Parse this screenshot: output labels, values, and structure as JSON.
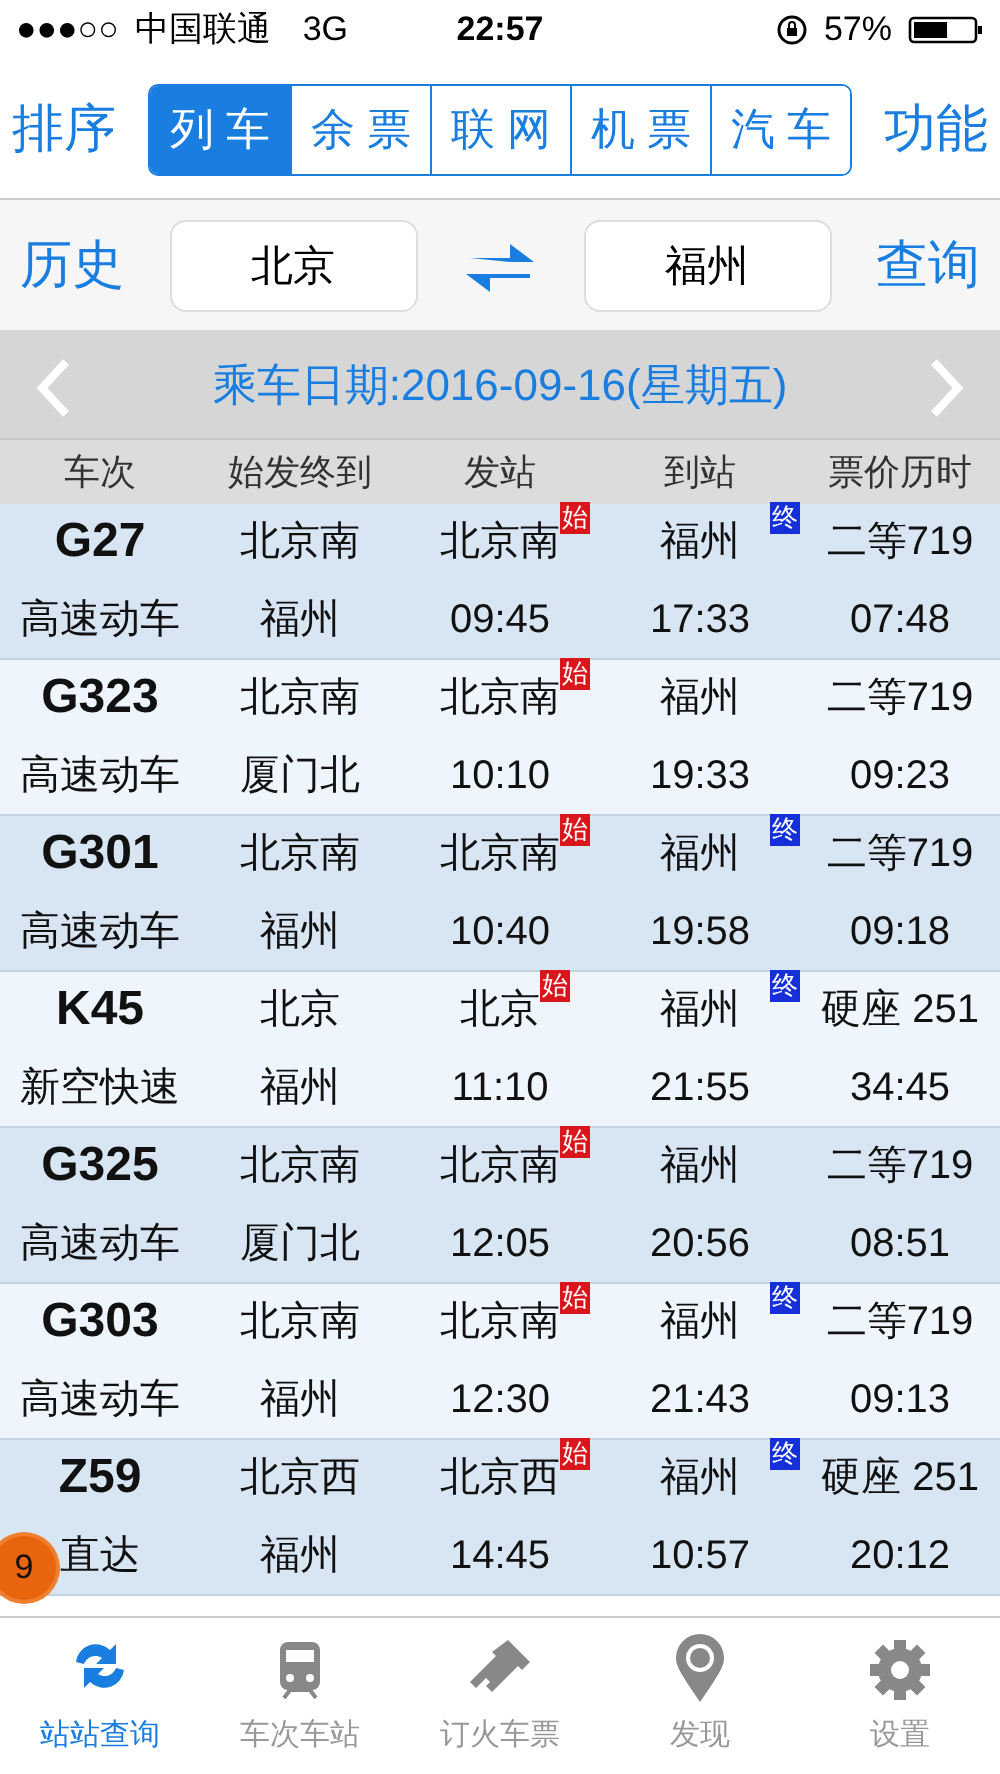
{
  "status_bar": {
    "signal": "●●●○○",
    "carrier": "中国联通",
    "network": "3G",
    "time": "22:57",
    "battery": "57%"
  },
  "top_bar": {
    "left_button": "排序",
    "right_button": "功能",
    "segments": [
      {
        "label": "列 车",
        "selected": true
      },
      {
        "label": "余 票",
        "selected": false
      },
      {
        "label": "联 网",
        "selected": false
      },
      {
        "label": "机 票",
        "selected": false
      },
      {
        "label": "汽 车",
        "selected": false
      }
    ]
  },
  "search": {
    "history_button": "历史",
    "from": "北京",
    "to": "福州",
    "query_button": "查询"
  },
  "date_bar": {
    "label": "乘车日期:2016-09-16(星期五)"
  },
  "table": {
    "columns": [
      "车次",
      "始发终到",
      "发站",
      "到站",
      "票价历时"
    ],
    "rows": [
      {
        "train": "G27",
        "type": "高速动车",
        "origin": "北京南",
        "terminus": "福州",
        "depart_station": "北京南",
        "depart_time": "09:45",
        "arrive_station": "福州",
        "arrive_time": "17:33",
        "price": "二等719",
        "duration": "07:48",
        "start_badge": "始",
        "end_badge": "终"
      },
      {
        "train": "G323",
        "type": "高速动车",
        "origin": "北京南",
        "terminus": "厦门北",
        "depart_station": "北京南",
        "depart_time": "10:10",
        "arrive_station": "福州",
        "arrive_time": "19:33",
        "price": "二等719",
        "duration": "09:23",
        "start_badge": "始"
      },
      {
        "train": "G301",
        "type": "高速动车",
        "origin": "北京南",
        "terminus": "福州",
        "depart_station": "北京南",
        "depart_time": "10:40",
        "arrive_station": "福州",
        "arrive_time": "19:58",
        "price": "二等719",
        "duration": "09:18",
        "start_badge": "始",
        "end_badge": "终"
      },
      {
        "train": "K45",
        "type": "新空快速",
        "origin": "北京",
        "terminus": "福州",
        "depart_station": "北京",
        "depart_time": "11:10",
        "arrive_station": "福州",
        "arrive_time": "21:55",
        "price": "硬座 251",
        "duration": "34:45",
        "start_badge": "始",
        "end_badge": "终"
      },
      {
        "train": "G325",
        "type": "高速动车",
        "origin": "北京南",
        "terminus": "厦门北",
        "depart_station": "北京南",
        "depart_time": "12:05",
        "arrive_station": "福州",
        "arrive_time": "20:56",
        "price": "二等719",
        "duration": "08:51",
        "start_badge": "始"
      },
      {
        "train": "G303",
        "type": "高速动车",
        "origin": "北京南",
        "terminus": "福州",
        "depart_station": "北京南",
        "depart_time": "12:30",
        "arrive_station": "福州",
        "arrive_time": "21:43",
        "price": "二等719",
        "duration": "09:13",
        "start_badge": "始",
        "end_badge": "终"
      },
      {
        "train": "Z59",
        "type": "直达",
        "origin": "北京西",
        "terminus": "福州",
        "depart_station": "北京西",
        "depart_time": "14:45",
        "arrive_station": "福州",
        "arrive_time": "10:57",
        "price": "硬座 251",
        "duration": "20:12",
        "start_badge": "始",
        "end_badge": "终"
      }
    ]
  },
  "count_badge": "9",
  "tab_bar": [
    {
      "label": "站站查询",
      "kind": "swap",
      "selected": true
    },
    {
      "label": "车次车站",
      "kind": "train",
      "selected": false
    },
    {
      "label": "订火车票",
      "kind": "ticket",
      "selected": false
    },
    {
      "label": "发现",
      "kind": "pin",
      "selected": false
    },
    {
      "label": "设置",
      "kind": "gear",
      "selected": false
    }
  ]
}
